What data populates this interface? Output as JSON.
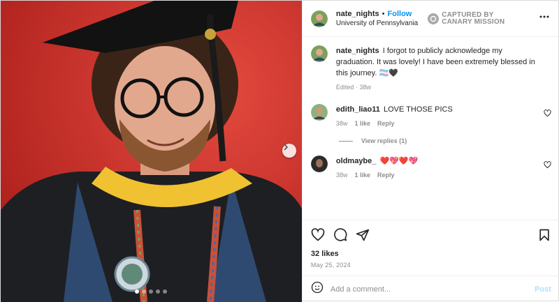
{
  "post": {
    "username": "nate_nights",
    "separator": "•",
    "follow_label": "Follow",
    "location": "University of Pennsylvania",
    "watermark": {
      "line1": "CAPTURED BY",
      "line2": "CANARY MISSION"
    },
    "caption": {
      "username": "nate_nights",
      "text": "I forgot to publicly acknowledge my graduation. It was lovely! I have been extremely blessed in this journey.",
      "emoji": "🏳️‍⚧️🖤",
      "meta": "Edited · 38w"
    },
    "comments": [
      {
        "username": "edith_liao11",
        "text": "LOVE THOSE PICS",
        "age": "38w",
        "likes": "1 like",
        "reply_label": "Reply",
        "view_replies": "View replies (1)"
      },
      {
        "username": "oldmaybe_",
        "text": "❤️💖❤️💖",
        "age": "38w",
        "likes": "1 like",
        "reply_label": "Reply"
      }
    ],
    "likes": "32 likes",
    "date": "May 25, 2024",
    "add_comment_placeholder": "Add a comment...",
    "post_label": "Post"
  },
  "carousel": {
    "slide_count": 5,
    "active_index": 0
  },
  "icons": {
    "more": "more-options-icon",
    "like": "heart-icon",
    "comment": "comment-icon",
    "share": "share-icon",
    "save": "bookmark-icon",
    "emoji": "emoji-icon",
    "next": "chevron-right-icon",
    "watermark": "watermark-logo-icon"
  },
  "colors": {
    "accent": "#0095f6",
    "muted": "#8e8e8e",
    "post_disabled": "#b2dffc",
    "photo_background": "#d8312b"
  }
}
